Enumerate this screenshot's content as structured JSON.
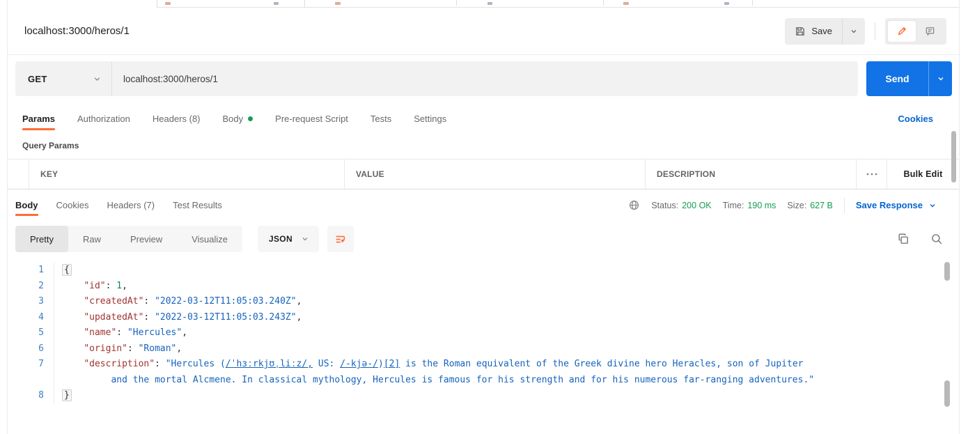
{
  "colors": {
    "accent": "#ff6c37",
    "link": "#0265d2",
    "send": "#1273e6",
    "success": "#149d52",
    "key": "#a0342f",
    "string": "#1663bb",
    "number": "#098658",
    "punct": "#2e2e2e",
    "lineno": "#3d7fc1"
  },
  "workspace": {
    "request_title": "localhost:3000/heros/1",
    "save_label": "Save"
  },
  "request": {
    "method": "GET",
    "url": "localhost:3000/heros/1",
    "send_label": "Send",
    "tabs": [
      {
        "label": "Params"
      },
      {
        "label": "Authorization"
      },
      {
        "label": "Headers (8)"
      },
      {
        "label": "Body"
      },
      {
        "label": "Pre-request Script"
      },
      {
        "label": "Tests"
      },
      {
        "label": "Settings"
      }
    ],
    "cookies_link": "Cookies",
    "query_params": {
      "title": "Query Params",
      "columns": [
        "KEY",
        "VALUE",
        "DESCRIPTION"
      ],
      "bulk_edit_label": "Bulk Edit"
    }
  },
  "response": {
    "tabs": [
      {
        "label": "Body"
      },
      {
        "label": "Cookies"
      },
      {
        "label": "Headers (7)"
      },
      {
        "label": "Test Results"
      }
    ],
    "status": {
      "label": "Status:",
      "value": "200 OK"
    },
    "time": {
      "label": "Time:",
      "value": "190 ms"
    },
    "size": {
      "label": "Size:",
      "value": "627 B"
    },
    "save_response_label": "Save Response",
    "view_tabs": [
      {
        "label": "Pretty"
      },
      {
        "label": "Raw"
      },
      {
        "label": "Preview"
      },
      {
        "label": "Visualize"
      }
    ],
    "format": "JSON",
    "body_rows": [
      {
        "num": "1",
        "tokens": [
          {
            "t": "{",
            "c": "p",
            "box": true
          }
        ]
      },
      {
        "num": "2",
        "tokens": [
          {
            "t": "    ",
            "c": "p"
          },
          {
            "t": "\"id\"",
            "c": "k"
          },
          {
            "t": ": ",
            "c": "p"
          },
          {
            "t": "1",
            "c": "n"
          },
          {
            "t": ",",
            "c": "p"
          }
        ]
      },
      {
        "num": "3",
        "tokens": [
          {
            "t": "    ",
            "c": "p"
          },
          {
            "t": "\"createdAt\"",
            "c": "k"
          },
          {
            "t": ": ",
            "c": "p"
          },
          {
            "t": "\"2022-03-12T11:05:03.240Z\"",
            "c": "s"
          },
          {
            "t": ",",
            "c": "p"
          }
        ]
      },
      {
        "num": "4",
        "tokens": [
          {
            "t": "    ",
            "c": "p"
          },
          {
            "t": "\"updatedAt\"",
            "c": "k"
          },
          {
            "t": ": ",
            "c": "p"
          },
          {
            "t": "\"2022-03-12T11:05:03.243Z\"",
            "c": "s"
          },
          {
            "t": ",",
            "c": "p"
          }
        ]
      },
      {
        "num": "5",
        "tokens": [
          {
            "t": "    ",
            "c": "p"
          },
          {
            "t": "\"name\"",
            "c": "k"
          },
          {
            "t": ": ",
            "c": "p"
          },
          {
            "t": "\"Hercules\"",
            "c": "s"
          },
          {
            "t": ",",
            "c": "p"
          }
        ]
      },
      {
        "num": "6",
        "tokens": [
          {
            "t": "    ",
            "c": "p"
          },
          {
            "t": "\"origin\"",
            "c": "k"
          },
          {
            "t": ": ",
            "c": "p"
          },
          {
            "t": "\"Roman\"",
            "c": "s"
          },
          {
            "t": ",",
            "c": "p"
          }
        ]
      },
      {
        "num": "7",
        "tokens": [
          {
            "t": "    ",
            "c": "p"
          },
          {
            "t": "\"description\"",
            "c": "k"
          },
          {
            "t": ": ",
            "c": "p"
          },
          {
            "t": "\"Hercules (",
            "c": "s"
          },
          {
            "t": "/ˈhɜːrkjʊˌliːz/,",
            "c": "su"
          },
          {
            "t": " US: ",
            "c": "s"
          },
          {
            "t": "/-kjə-/",
            "c": "su"
          },
          {
            "t": ")",
            "c": "s"
          },
          {
            "t": "[2]",
            "c": "su"
          },
          {
            "t": " is the Roman equivalent of the Greek divine hero Heracles, son of Jupiter",
            "c": "s"
          }
        ]
      },
      {
        "num": "",
        "tokens": [
          {
            "t": "         ",
            "c": "p"
          },
          {
            "t": "and the mortal Alcmene. In classical mythology, Hercules is famous for his strength and for his numerous far-ranging adventures.\"",
            "c": "s"
          }
        ]
      },
      {
        "num": "8",
        "tokens": [
          {
            "t": "}",
            "c": "p",
            "box": true
          }
        ]
      }
    ]
  }
}
